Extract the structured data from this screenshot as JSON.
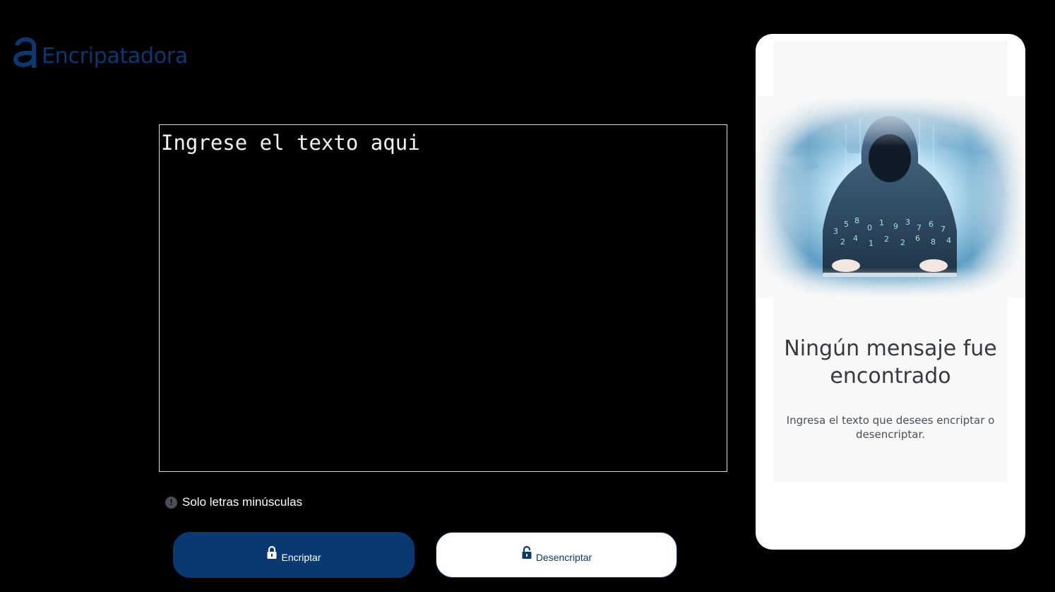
{
  "brand": {
    "name": "Encripatadora",
    "logo_icon": "alura-a-logo-icon",
    "color": "#0A3871"
  },
  "editor": {
    "placeholder": "Ingrese el texto aqui"
  },
  "hint": {
    "icon": "exclamation-circle-icon",
    "text": "Solo letras minúsculas"
  },
  "actions": {
    "encrypt_label": "Encriptar",
    "encrypt_icon": "lock-icon",
    "decrypt_label": "Desencriptar",
    "decrypt_icon": "unlock-icon"
  },
  "output_panel": {
    "illustration": "hooded-hacker-illustration",
    "title": "Ningún mensaje fue encontrado",
    "description": "Ingresa el texto que desees encriptar o desencriptar."
  },
  "colors": {
    "background": "#000000",
    "primary": "#0A3871",
    "panel": "#FFFFFF",
    "panel_inner": "#F8F8F8",
    "title_text": "#343A40",
    "body_text": "#495057"
  }
}
